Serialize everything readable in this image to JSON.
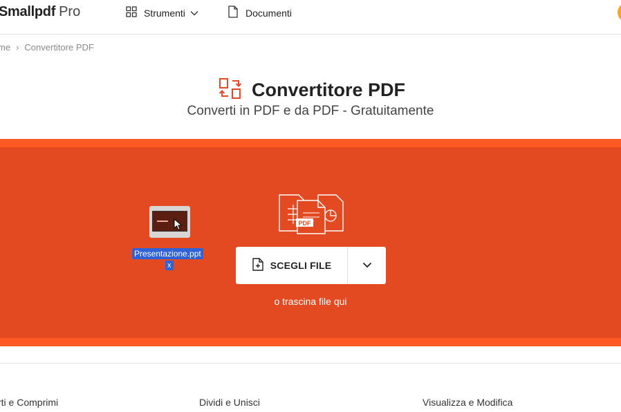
{
  "header": {
    "brand_bold": "Smallpdf",
    "brand_light": "Pro",
    "tools_label": "Strumenti",
    "documents_label": "Documenti"
  },
  "breadcrumb": {
    "home": "me",
    "separator": "›",
    "current": "Convertitore PDF"
  },
  "hero": {
    "title": "Convertitore PDF",
    "subtitle": "Converti in PDF e da PDF - Gratuitamente"
  },
  "dropzone": {
    "choose_label": "SCEGLI FILE",
    "hint": "o trascina file qui",
    "pdf_tag": "PDF",
    "dragged_file_name": "Presentazione.ppt",
    "dragged_file_suffix": "x"
  },
  "footer": {
    "col1": "rti e Comprimi",
    "col2": "Dividi e Unisci",
    "col3": "Visualizza e Modifica"
  },
  "colors": {
    "brand_accent": "#ff5a24",
    "dropzone_bg": "#e34a22",
    "selection_blue": "#2f62d6",
    "avatar": "#f5a623"
  },
  "icons": {
    "tools": "grid-icon",
    "documents": "document-icon",
    "converter": "convert-arrows-icon",
    "choose": "file-plus-icon",
    "dropdown": "chevron-down-icon"
  }
}
